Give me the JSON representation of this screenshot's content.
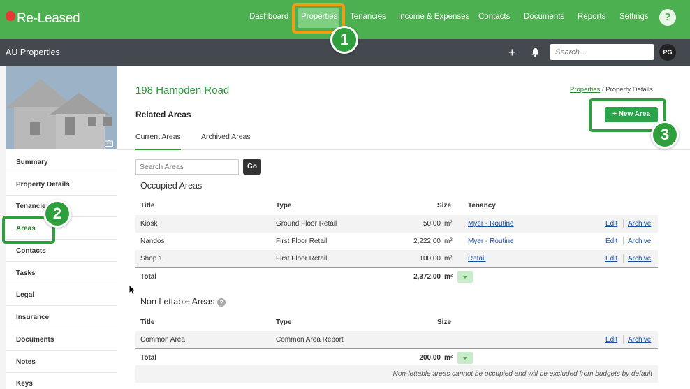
{
  "app": {
    "logo_text": "Re-Leased"
  },
  "nav": {
    "items": [
      "Dashboard",
      "Properties",
      "Tenancies",
      "Income & Expenses",
      "Contacts",
      "Documents",
      "Reports",
      "Settings"
    ],
    "active": "Properties",
    "help_label": "?"
  },
  "subbar": {
    "title": "AU Properties",
    "add_label": "+",
    "search_placeholder": "Search...",
    "avatar": "PG"
  },
  "sidebar": {
    "items": [
      "Summary",
      "Property Details",
      "Tenancies",
      "Areas",
      "Contacts",
      "Tasks",
      "Legal",
      "Insurance",
      "Documents",
      "Notes",
      "Keys"
    ],
    "active": "Areas"
  },
  "page": {
    "title": "198 Hampden Road",
    "breadcrumb_link": "Properties",
    "breadcrumb_sep": "/",
    "breadcrumb_current": "Property Details",
    "section_title": "Related Areas",
    "new_button": "+ New Area",
    "tabs": [
      "Current Areas",
      "Archived Areas"
    ],
    "active_tab": "Current Areas",
    "search_placeholder": "Search Areas",
    "go_label": "Go"
  },
  "occupied": {
    "heading": "Occupied Areas",
    "columns": [
      "Title",
      "Type",
      "Size",
      "Tenancy"
    ],
    "rows": [
      {
        "title": "Kiosk",
        "type": "Ground Floor Retail",
        "size": "50.00",
        "unit": "m²",
        "tenancy": "Myer - Routine"
      },
      {
        "title": "Nandos",
        "type": "First Floor Retail",
        "size": "2,222.00",
        "unit": "m²",
        "tenancy": "Myer - Routine"
      },
      {
        "title": "Shop 1",
        "type": "First Floor Retail",
        "size": "100.00",
        "unit": "m²",
        "tenancy": "Retail"
      }
    ],
    "total_label": "Total",
    "total": "2,372.00",
    "total_unit": "m²"
  },
  "non_lettable": {
    "heading": "Non Lettable Areas",
    "help": "?",
    "columns": [
      "Title",
      "Type",
      "Size"
    ],
    "rows": [
      {
        "title": "Common Area",
        "type": "Common Area Report"
      }
    ],
    "total_label": "Total",
    "total": "200.00",
    "total_unit": "m²",
    "note": "Non-lettable areas cannot be occupied and will be excluded from budgets by default"
  },
  "row_actions": {
    "edit": "Edit",
    "archive": "Archive"
  },
  "annotations": {
    "steps": [
      "1",
      "2",
      "3"
    ],
    "box_color": "#f39c12",
    "green_box_color": "#2f9f3e"
  },
  "colors": {
    "brand_green": "#4caf50",
    "dark_bar": "#43494f",
    "button_green": "#2ba34a"
  }
}
